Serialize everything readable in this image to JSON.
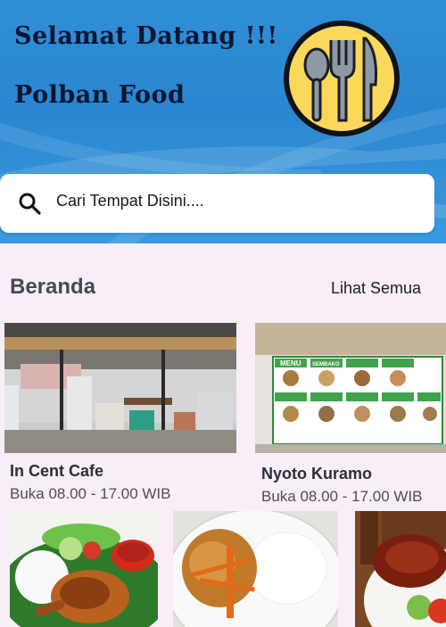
{
  "header": {
    "greeting": "Selamat Datang !!!",
    "app_name": "Polban Food",
    "logo_icon": "fork-spoon-knife-icon"
  },
  "search": {
    "icon": "search-icon",
    "placeholder": "Cari Tempat Disini...."
  },
  "section": {
    "title": "Beranda",
    "see_all": "Lihat Semua"
  },
  "places": [
    {
      "name": "In Cent Cafe",
      "hours": "Buka 08.00 - 17.00 WIB"
    },
    {
      "name": "Nyoto Kuramo",
      "hours": "Buka 08.00 - 17.00 WIB"
    }
  ],
  "menu_banner": {
    "heading": "MENU",
    "subheading": "SEMBAKO"
  },
  "colors": {
    "header_blue": "#2f8fd6",
    "logo_yellow": "#fbd85a",
    "page_bg": "#f8eef8"
  }
}
